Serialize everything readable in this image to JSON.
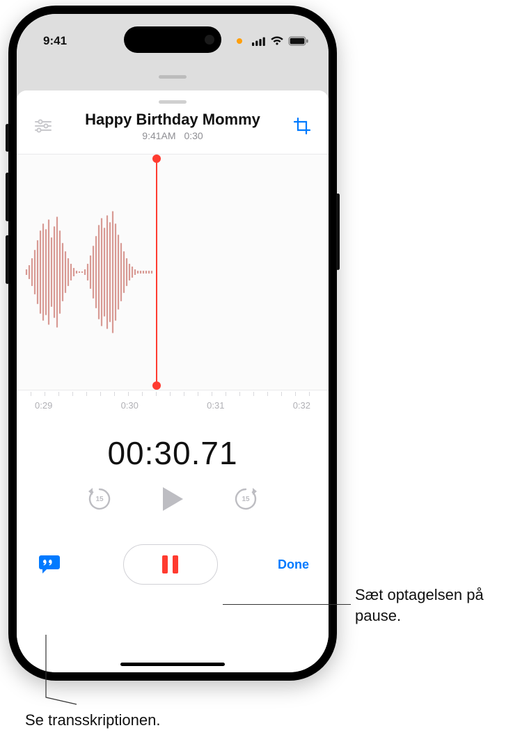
{
  "status": {
    "time": "9:41"
  },
  "recording": {
    "title": "Happy Birthday Mommy",
    "time_label": "9:41AM",
    "duration_label": "0:30"
  },
  "ticks": {
    "t0": "0:29",
    "t1": "0:30",
    "t2": "0:31",
    "t3": "0:32"
  },
  "timecode": "00:30.71",
  "controls": {
    "back_seconds": "15",
    "forward_seconds": "15",
    "done_label": "Done"
  },
  "callouts": {
    "pause": "Sæt optagelsen på pause.",
    "transcribe": "Se transskriptionen."
  }
}
